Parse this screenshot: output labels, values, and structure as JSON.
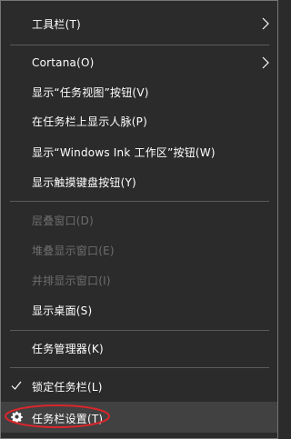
{
  "menu": {
    "items": [
      {
        "label": "工具栏(T)",
        "has_submenu": true,
        "disabled": false
      },
      {
        "label": "Cortana(O)",
        "has_submenu": true,
        "disabled": false
      },
      {
        "label": "显示“任务视图”按钮(V)",
        "has_submenu": false,
        "disabled": false
      },
      {
        "label": "在任务栏上显示人脉(P)",
        "has_submenu": false,
        "disabled": false
      },
      {
        "label": "显示“Windows Ink 工作区”按钮(W)",
        "has_submenu": false,
        "disabled": false
      },
      {
        "label": "显示触摸键盘按钮(Y)",
        "has_submenu": false,
        "disabled": false
      },
      {
        "label": "层叠窗口(D)",
        "has_submenu": false,
        "disabled": true
      },
      {
        "label": "堆叠显示窗口(E)",
        "has_submenu": false,
        "disabled": true
      },
      {
        "label": "并排显示窗口(I)",
        "has_submenu": false,
        "disabled": true
      },
      {
        "label": "显示桌面(S)",
        "has_submenu": false,
        "disabled": false
      },
      {
        "label": "任务管理器(K)",
        "has_submenu": false,
        "disabled": false
      },
      {
        "label": "锁定任务栏(L)",
        "has_submenu": false,
        "disabled": false,
        "checked": true
      },
      {
        "label": "任务栏设置(T)",
        "has_submenu": false,
        "disabled": false,
        "icon": "gear-icon",
        "highlighted": true
      }
    ]
  },
  "colors": {
    "background": "#2b2b2b",
    "text": "#ffffff",
    "disabled_text": "#6d6d6d",
    "separator": "#5b5b5b",
    "highlight": "#414141",
    "annotation": "#d9262b"
  }
}
